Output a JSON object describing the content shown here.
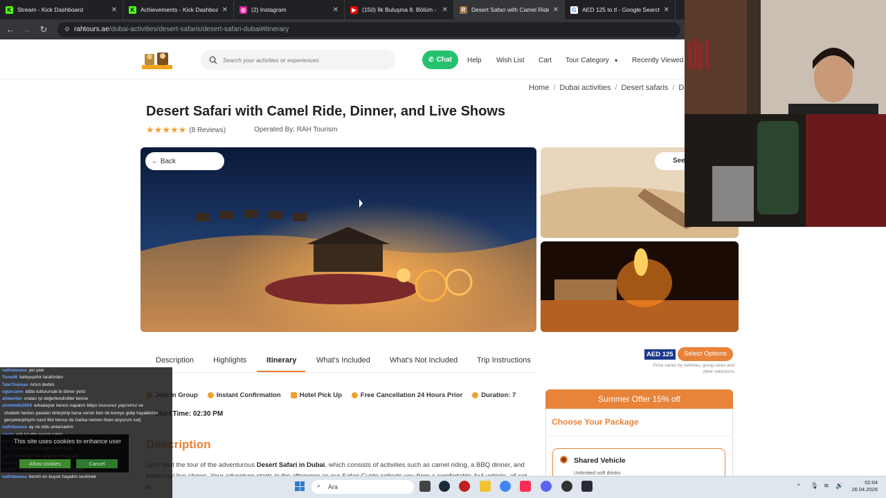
{
  "browser": {
    "tabs": [
      {
        "title": "Stream - Kick Dashboard",
        "color": "#53fc18",
        "glyph": "K"
      },
      {
        "title": "Achievements - Kick Dashboard",
        "color": "#53fc18",
        "glyph": "K"
      },
      {
        "title": "(2) Instagram",
        "color": "#d6249f",
        "glyph": "◎"
      },
      {
        "title": "(150) İlk Buluşma 8. Bölüm - Yo",
        "color": "#ff0000",
        "glyph": "▶"
      },
      {
        "title": "Desert Safari with Camel Ride, I",
        "color": "#a0744a",
        "glyph": "R"
      },
      {
        "title": "AED 125 to tl - Google Search",
        "color": "#4285f4",
        "glyph": "G"
      }
    ],
    "url_host": "rahtours.ae",
    "url_path": "/dubai-activities/desert-safaris/desert-safari-dubai#itinerary"
  },
  "header": {
    "search_placeholder": "Search your activities or experiences",
    "chat_label": "Chat",
    "nav": [
      "Help",
      "Wish List",
      "Cart",
      "Tour Category",
      "Recently Viewed"
    ]
  },
  "breadcrumb": [
    "Home",
    "Dubai activities",
    "Desert safaris",
    "Des"
  ],
  "product": {
    "title": "Desert Safari with Camel Ride, Dinner, and Live Shows",
    "stars": 5,
    "reviews": "(8 Reviews)",
    "operated_by": "Operated By: RAH Tourism",
    "back_label": "← Back",
    "see_all_label": "See"
  },
  "tabs": [
    "Description",
    "Highlights",
    "Itinerary",
    "What's Included",
    "What's Not Included",
    "Trip Instructions"
  ],
  "price": {
    "amount": "AED 125",
    "select_label": "Select Options",
    "note": "Price varies by vehicles, group sizes and other selections"
  },
  "features": [
    "Join In Group",
    "Instant Confirmation",
    "Hotel Pick Up",
    "Free Cancellation 24 Hours Prior",
    "Duration: 7"
  ],
  "start_time": "Start Time: 02:30 PM",
  "description": {
    "heading": "Description",
    "text_1": "Let's start the tour of the adventurous ",
    "bold": "Desert Safari in Dubai",
    "text_2": ", which consists of activities such as camel riding, a BBQ dinner, and traditional live shows. Your adventure starts in the afternoon as our Safari Guide collects you from a comfortable 4x4 vehicle, all set to"
  },
  "package": {
    "offer": "Summer Offer 15% off",
    "heading": "Choose Your Package",
    "option_name": "Shared Vehicle",
    "option_sub": "Unlimited soft drinks"
  },
  "stream_chat": [
    {
      "user": "nathdavasa",
      "msg": "yei yaw"
    },
    {
      "user": "Tuna46",
      "msg": "bahçeşehir tarafından"
    },
    {
      "user": "TaleThomas",
      "msg": "Artım dedim"
    },
    {
      "user": "ugurcanw",
      "msg": "iddia tutturursak bi döner yeriz"
    },
    {
      "user": "ahbenfan",
      "msg": "oraları iyi değerlendirdiler bence"
    },
    {
      "user": "ahmetefe2004",
      "msg": "arkadaşlar bence napalım biliyo musunuz yayınımız ve"
    },
    {
      "user": "",
      "msg": "chatteki herkes paraları birleştirip bana versin ben de koreye gidip hayallerimi"
    },
    {
      "user": "",
      "msg": "gerçekleştiriyim nasıl fikir bence de harika nemen İbani atıyorum lud)"
    },
    {
      "user": "nathdavasa",
      "msg": "ay ne oldu anlamadım"
    },
    {
      "user": "uncle",
      "msg": "çok iyi olm sessiz sakin"
    },
    {
      "user": "ahmedsftg",
      "msg": "bide bizim yaşadığımız yerler ahshxjdksps"
    },
    {
      "user": "TaleThomas",
      "msg": "Çölde gece vakti turu"
    },
    {
      "user": "uncle",
      "msg": "bunu ben de istiyom tuncay abi"
    },
    {
      "user": "Tuna46",
      "msg": "esenyurt"
    },
    {
      "user": "BotRix",
      "msg": "Thank you for the follow ffxgfield"
    },
    {
      "user": "nathdavasa",
      "msg": "benim en buyuk hayalim sevilmek"
    }
  ],
  "cookie": {
    "text": "This site uses cookies to enhance user",
    "allow": "Allow cookies",
    "cancel": "Cancel"
  },
  "taskbar": {
    "search_label": "Ara",
    "time": "02:04",
    "date": "26.04.2026"
  }
}
